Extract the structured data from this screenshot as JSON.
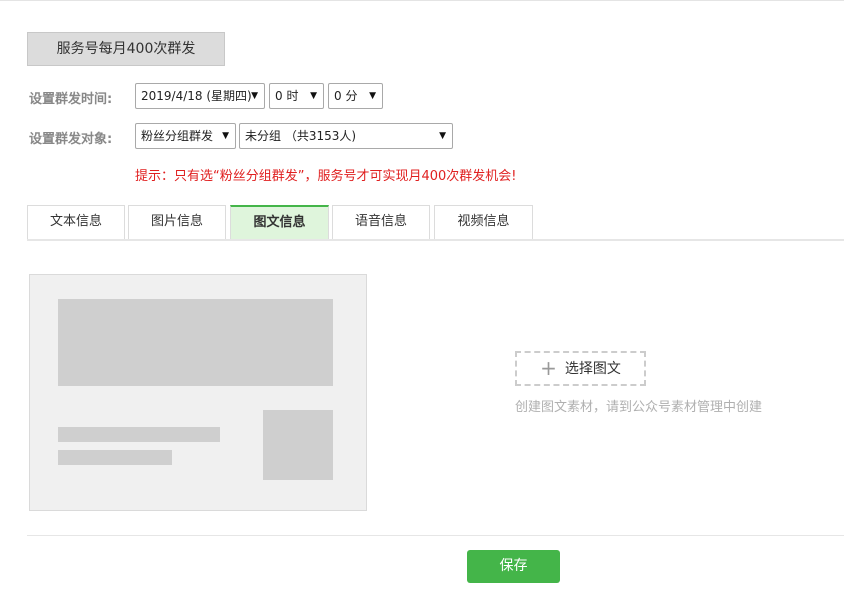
{
  "header": {
    "title": "服务号每月400次群发"
  },
  "schedule": {
    "label": "设置群发时间:",
    "date": "2019/4/18 (星期四)",
    "hour": "0 时",
    "minute": "0 分"
  },
  "target": {
    "label": "设置群发对象:",
    "mode": "粉丝分组群发",
    "group": "未分组 （共3153人)"
  },
  "tip": "提示：只有选“粉丝分组群发”，服务号才可实现月400次群发机会!",
  "tabs": [
    {
      "label": "文本信息"
    },
    {
      "label": "图片信息"
    },
    {
      "label": "图文信息"
    },
    {
      "label": "语音信息"
    },
    {
      "label": "视频信息"
    }
  ],
  "picker": {
    "button_label": "选择图文",
    "hint": "创建图文素材，请到公众号素材管理中创建"
  },
  "footer": {
    "save_label": "保存"
  },
  "colors": {
    "accent": "#44b549",
    "tip": "#e02020",
    "active_tab_bg": "#dff5dc"
  },
  "icons": {
    "dropdown": "caret-down-icon",
    "add": "plus-icon"
  }
}
